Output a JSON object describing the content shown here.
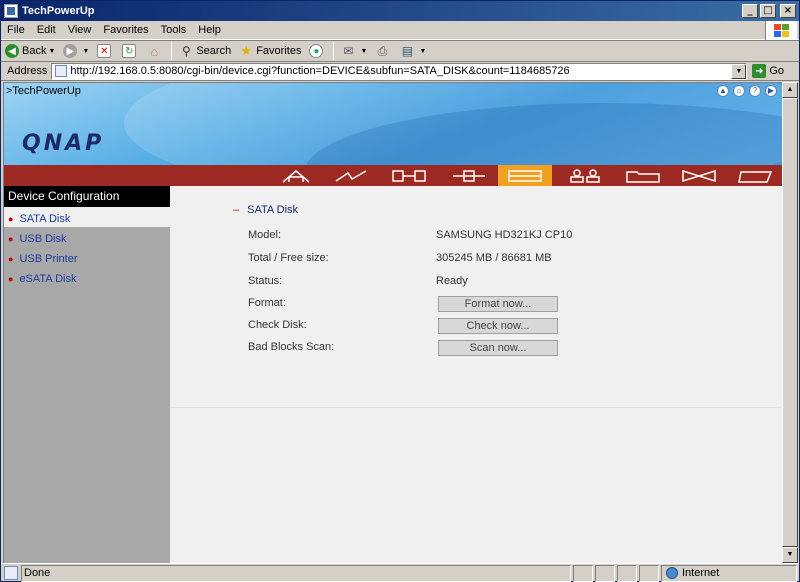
{
  "window": {
    "title": "TechPowerUp"
  },
  "menubar": {
    "items": [
      "File",
      "Edit",
      "View",
      "Favorites",
      "Tools",
      "Help"
    ]
  },
  "toolbar": {
    "back": "Back",
    "search": "Search",
    "favorites": "Favorites"
  },
  "addressbar": {
    "label": "Address",
    "url": "http://192.168.0.5:8080/cgi-bin/device.cgi?function=DEVICE&subfun=SATA_DISK&count=1184685726",
    "go": "Go"
  },
  "banner": {
    "crumb": ">TechPowerUp",
    "logo": "QNAP"
  },
  "sidebar": {
    "title": "Device Configuration",
    "items": [
      {
        "label": "SATA Disk"
      },
      {
        "label": "USB Disk"
      },
      {
        "label": "USB Printer"
      },
      {
        "label": "eSATA Disk"
      }
    ]
  },
  "main": {
    "section_title": "SATA Disk",
    "model_label": "Model:",
    "model_value": "SAMSUNG HD321KJ CP10",
    "size_label": "Total / Free size:",
    "size_value": "305245 MB / 86681 MB",
    "status_label": "Status:",
    "status_value": "Ready",
    "format_label": "Format:",
    "format_button": "Format now...",
    "check_label": "Check Disk:",
    "check_button": "Check now...",
    "scan_label": "Bad Blocks Scan:",
    "scan_button": "Scan now..."
  },
  "statusbar": {
    "text": "Done",
    "zone": "Internet"
  },
  "colors": {
    "nav_strip": "#9c2a22",
    "nav_active": "#f0a020",
    "sidebar_title_bg": "#000000",
    "link": "#1a3aa0"
  }
}
